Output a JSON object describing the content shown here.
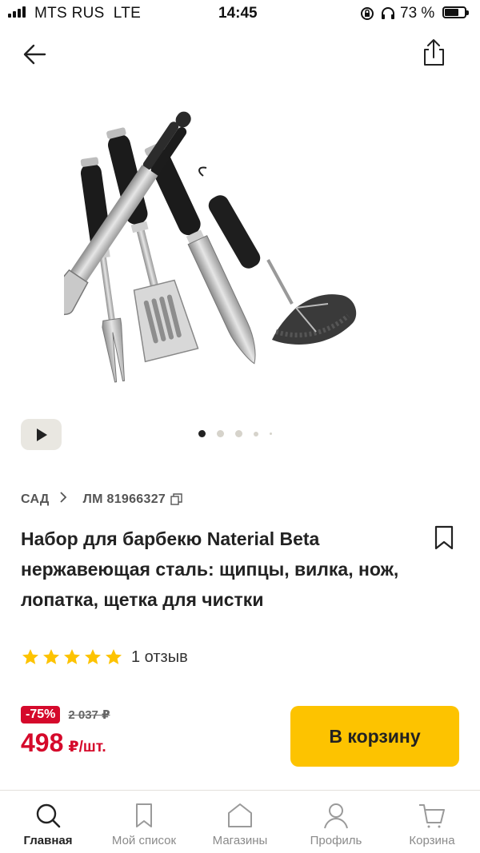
{
  "status_bar": {
    "carrier": "MTS RUS",
    "network": "LTE",
    "time": "14:45",
    "battery": "73 %"
  },
  "header": {
    "back_icon": "arrow-left-icon",
    "share_icon": "share-icon"
  },
  "gallery": {
    "image_subject": "bbq-tool-set",
    "play_icon": "play-icon",
    "active_index": 0,
    "total": 5
  },
  "breadcrumb": {
    "category": "САД",
    "article": "ЛМ 81966327"
  },
  "product": {
    "title": "Набор для барбекю Naterial Beta нержавеющая сталь: щипцы, вилка, нож, лопатка, щетка для чистки",
    "rating": 5,
    "reviews": "1 отзыв"
  },
  "price": {
    "discount": "-75%",
    "old_price": "2 037 ₽",
    "new_price": "498",
    "unit": "₽/шт."
  },
  "actions": {
    "add_to_cart": "В корзину"
  },
  "tabs": [
    {
      "label": "Главная",
      "icon": "search-icon"
    },
    {
      "label": "Мой список",
      "icon": "bookmark-icon"
    },
    {
      "label": "Магазины",
      "icon": "store-icon"
    },
    {
      "label": "Профиль",
      "icon": "user-icon"
    },
    {
      "label": "Корзина",
      "icon": "cart-icon"
    }
  ],
  "colors": {
    "accent": "#fdc300",
    "sale": "#d5092b",
    "text": "#222222"
  }
}
